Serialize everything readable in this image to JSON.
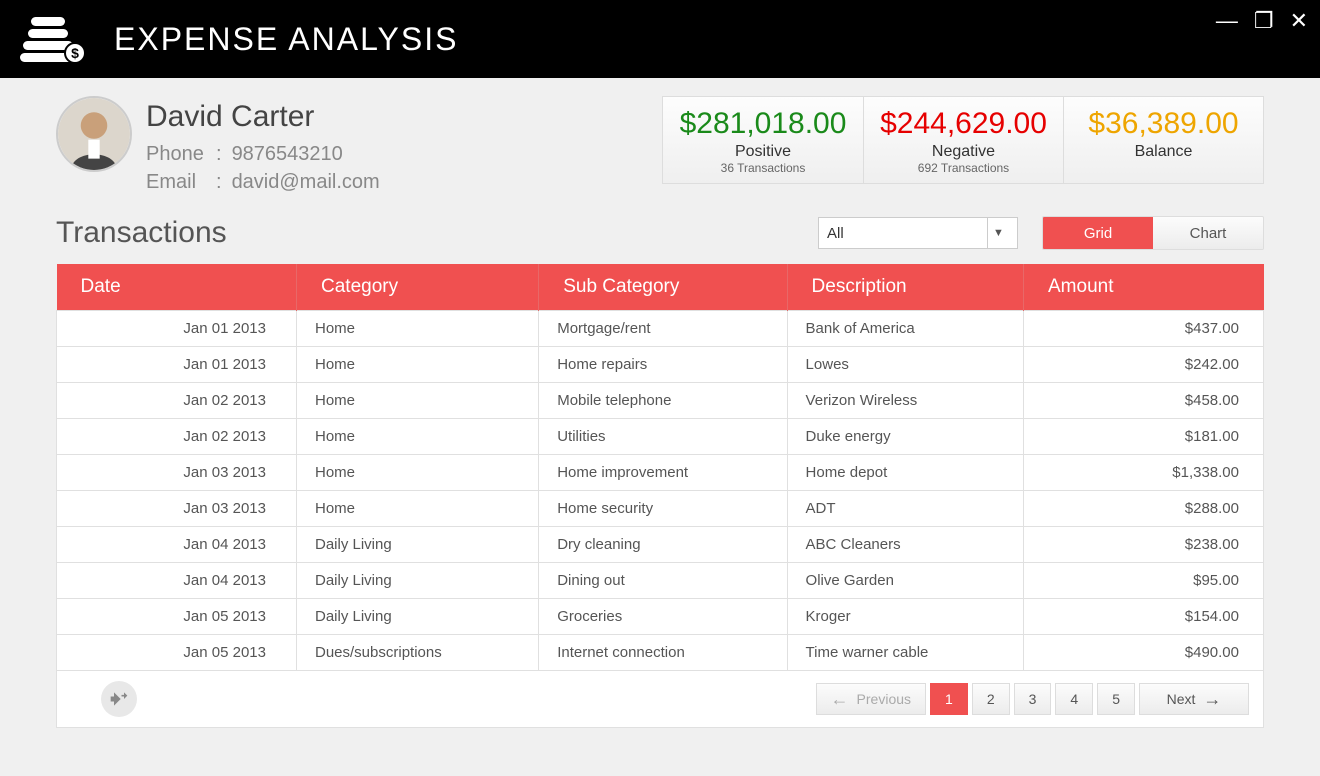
{
  "app": {
    "title": "EXPENSE ANALYSIS"
  },
  "window": {
    "minimize": "—",
    "maximize": "❐",
    "close": "✕"
  },
  "profile": {
    "name": "David Carter",
    "phone_label": "Phone",
    "phone": "9876543210",
    "email_label": "Email",
    "email": "david@mail.com"
  },
  "summary": {
    "positive": {
      "amount": "$281,018.00",
      "label": "Positive",
      "sub": "36 Transactions"
    },
    "negative": {
      "amount": "$244,629.00",
      "label": "Negative",
      "sub": "692 Transactions"
    },
    "balance": {
      "amount": "$36,389.00",
      "label": "Balance",
      "sub": ""
    }
  },
  "section": {
    "title": "Transactions"
  },
  "filter": {
    "selected": "All",
    "caret": "▼"
  },
  "view": {
    "grid": "Grid",
    "chart": "Chart"
  },
  "table": {
    "headers": {
      "date": "Date",
      "category": "Category",
      "subcategory": "Sub Category",
      "description": "Description",
      "amount": "Amount"
    },
    "rows": [
      {
        "date": "Jan 01 2013",
        "category": "Home",
        "sub": "Mortgage/rent",
        "desc": "Bank of America",
        "amount": "$437.00"
      },
      {
        "date": "Jan 01 2013",
        "category": "Home",
        "sub": "Home repairs",
        "desc": "Lowes",
        "amount": "$242.00"
      },
      {
        "date": "Jan 02 2013",
        "category": "Home",
        "sub": "Mobile telephone",
        "desc": "Verizon Wireless",
        "amount": "$458.00"
      },
      {
        "date": "Jan 02 2013",
        "category": "Home",
        "sub": "Utilities",
        "desc": "Duke energy",
        "amount": "$181.00"
      },
      {
        "date": "Jan 03 2013",
        "category": "Home",
        "sub": "Home improvement",
        "desc": "Home depot",
        "amount": "$1,338.00"
      },
      {
        "date": "Jan 03 2013",
        "category": "Home",
        "sub": "Home security",
        "desc": "ADT",
        "amount": "$288.00"
      },
      {
        "date": "Jan 04 2013",
        "category": "Daily Living",
        "sub": "Dry cleaning",
        "desc": "ABC Cleaners",
        "amount": "$238.00"
      },
      {
        "date": "Jan 04 2013",
        "category": "Daily Living",
        "sub": "Dining out",
        "desc": "Olive Garden",
        "amount": "$95.00"
      },
      {
        "date": "Jan 05 2013",
        "category": "Daily Living",
        "sub": "Groceries",
        "desc": "Kroger",
        "amount": "$154.00"
      },
      {
        "date": "Jan 05 2013",
        "category": "Dues/subscriptions",
        "sub": "Internet connection",
        "desc": "Time warner cable",
        "amount": "$490.00"
      }
    ]
  },
  "pager": {
    "prev": "Previous",
    "next": "Next",
    "pages": [
      "1",
      "2",
      "3",
      "4",
      "5"
    ],
    "active": "1"
  }
}
